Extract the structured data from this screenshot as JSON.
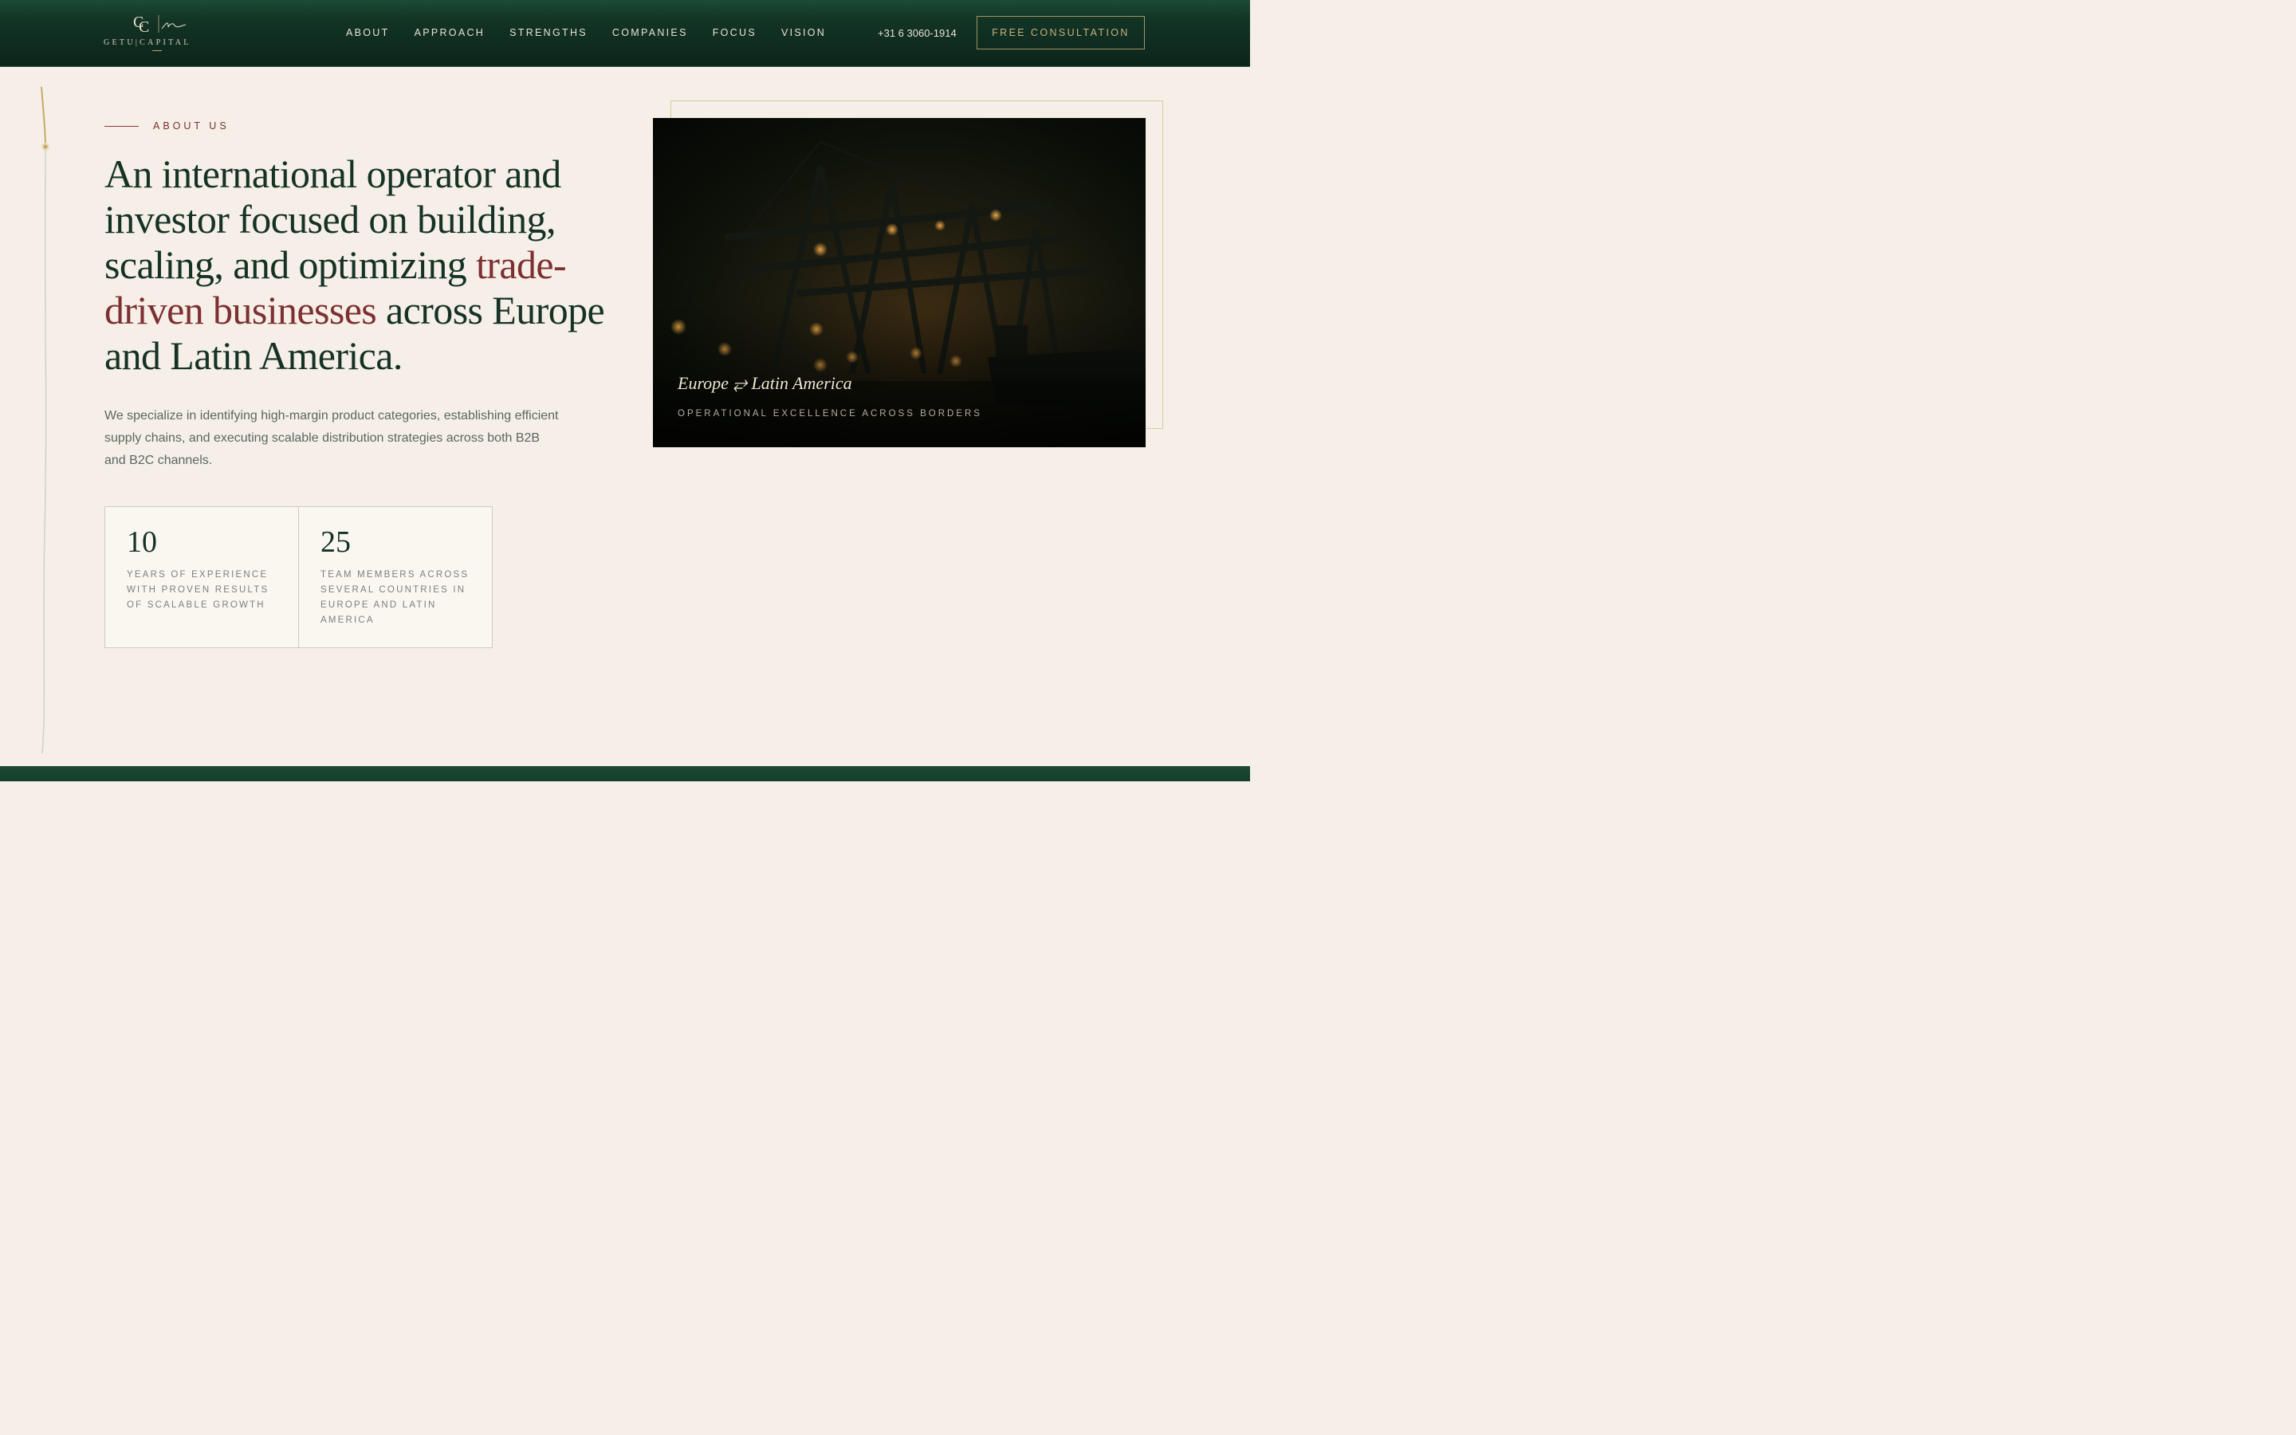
{
  "header": {
    "logo_monogram": "GC",
    "logo_word": "GETU|CAPITAL",
    "nav": [
      "ABOUT",
      "APPROACH",
      "STRENGTHS",
      "COMPANIES",
      "FOCUS",
      "VISION"
    ],
    "phone": "+31 6 3060-1914",
    "cta_label": "FREE CONSULTATION"
  },
  "about": {
    "eyebrow": "ABOUT US",
    "headline_part1": "An international operator and investor focused on building, scaling, and optimizing ",
    "headline_highlight": "trade-driven businesses",
    "headline_part2": " across Europe and Latin America.",
    "description": "We specialize in identifying high-margin product categories, establishing efficient supply chains, and executing scalable distribution strategies across both B2B and B2C channels.",
    "stats": [
      {
        "value": "10",
        "label": "Years of experience with proven results of scalable growth"
      },
      {
        "value": "25",
        "label": "Team members across several countries in Europe and Latin America"
      }
    ]
  },
  "feature_image": {
    "title": "Europe ⥂ Latin America",
    "subtitle": "OPERATIONAL EXCELLENCE ACROSS BORDERS"
  },
  "colors": {
    "header_green": "#0f2c20",
    "accent_red": "#7d2f31",
    "gold": "#c7b07a",
    "background": "#f5efe7"
  }
}
